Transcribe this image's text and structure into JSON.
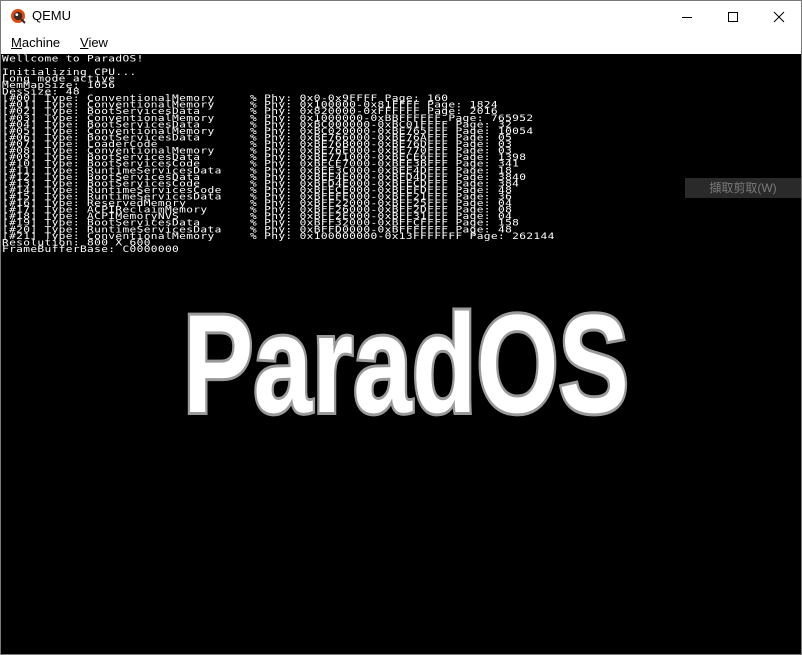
{
  "window": {
    "title": "QEMU",
    "controls": {
      "minimize": "minimize",
      "maximize": "maximize",
      "close": "close"
    }
  },
  "menubar": {
    "items": [
      {
        "label_first": "M",
        "label_rest": "achine"
      },
      {
        "label_first": "V",
        "label_rest": "iew"
      }
    ]
  },
  "console": {
    "lines": [
      "Wellcome to ParadOS!",
      "",
      "Initializing CPU...",
      "Long mode active",
      "MemMapSize: 1056",
      "DesSize: 48",
      "[#00] Type: ConventionalMemory     % Phy: 0x0-0x9FFFF Page: 160",
      "[#01] Type: ConventionalMemory     % Phy: 0x100000-0x81FFFF Page: 1824",
      "[#02] Type: BootServicesData       % Phy: 0x820000-0xFFFFFF Page: 2016",
      "[#03] Type: ConventionalMemory     % Phy: 0x1000000-0xBBFFFFFF Page: 765952",
      "[#04] Type: BootServicesData       % Phy: 0xBC000000-0xBC01FFFF Page: 32",
      "[#05] Type: ConventionalMemory     % Phy: 0xBC020000-0xBE765FFF Page: 10054",
      "[#06] Type: BootServicesData       % Phy: 0xBE766000-0xBE76AFFF Page: 05",
      "[#07] Type: LoaderCode             % Phy: 0xBE76B000-0xBE76DFFF Page: 03",
      "[#08] Type: ConventionalMemory     % Phy: 0xBE76E000-0xBE770FFF Page: 03",
      "[#09] Type: BootServicesData       % Phy: 0xBE771000-0xBECE6FFF Page: 1398",
      "[#10] Type: BootServicesCode       % Phy: 0xBECE7000-0xBEE3BFFF Page: 341",
      "[#11] Type: RuntimeServicesData    % Phy: 0xBEE3C000-0xBEE4DFFF Page: 18",
      "[#12] Type: BootServicesData       % Phy: 0xBEE4E000-0xBFD4DFFF Page: 3840",
      "[#13] Type: BootServicesCode       % Phy: 0xBFD4E000-0xBFECDFFF Page: 384",
      "[#14] Type: RuntimeServicesCode    % Phy: 0xBFECE000-0xBFEFDFFF Page: 48",
      "[#15] Type: RuntimeServicesData    % Phy: 0xBFEFE000-0xBFF21FFF Page: 36",
      "[#16] Type: ReservedMemory         % Phy: 0xBFF22000-0xBFF25FFF Page: 04",
      "[#17] Type: ACPIReclaimMemory      % Phy: 0xBFF26000-0xBFF2DFFF Page: 08",
      "[#18] Type: ACPIMemoryNVS          % Phy: 0xBFF2E000-0xBFF31FFF Page: 04",
      "[#19] Type: BootServicesData       % Phy: 0xBFF32000-0xBFFCFFFF Page: 158",
      "[#20] Type: RuntimeServicesData    % Phy: 0xBFFD0000-0xBFFFFFFF Page: 48",
      "[#21] Type: ConventionalMemory     % Phy: 0x100000000-0x13FFFFFFF Page: 262144",
      "Resolution: 800 X 600",
      "FrameBufferBase: C0000000"
    ]
  },
  "overlay": {
    "ime_hint": "擷取剪取(W)",
    "logo_text": "ParadOS"
  },
  "colors": {
    "screen_bg": "#000000",
    "console_text": "#ffffff",
    "logo_fill": "#ffffff",
    "logo_stroke": "#9a9a9a"
  }
}
